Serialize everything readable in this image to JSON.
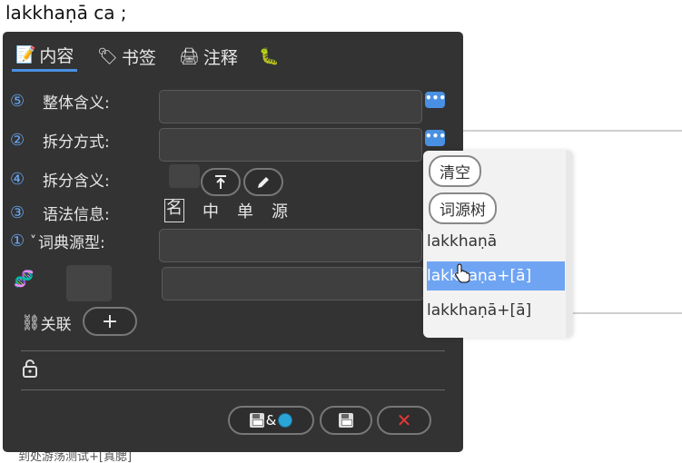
{
  "background": {
    "title_text": "lakkhaṇā  ca          ;",
    "bottom_text": "到处游荡测试+[真腮]"
  },
  "tabs": [
    {
      "icon": "📝",
      "label": "内容"
    },
    {
      "icon": "🏷",
      "label": "书签"
    },
    {
      "icon": "🖨",
      "label": "注释"
    },
    {
      "icon": "🐛",
      "label": ""
    }
  ],
  "rows": {
    "meaning": {
      "num": "⑤",
      "label": "整体含义:"
    },
    "split_method": {
      "num": "②",
      "label": "拆分方式:"
    },
    "split_meaning": {
      "num": "④",
      "label": "拆分含义:"
    },
    "grammar": {
      "num": "③",
      "label": "语法信息:",
      "tags": [
        "名",
        "中",
        "单",
        "源"
      ]
    },
    "dict_base": {
      "num": "①",
      "label": "词典源型:",
      "chevron": "˅"
    },
    "dna_icon": "🧬"
  },
  "chip_label": "•••",
  "relation": {
    "icon": "⛓",
    "label": "关联",
    "add": "+"
  },
  "lock_icon": "🔒",
  "footer": {
    "save_share_amp": "&",
    "cancel_symbol": "✕"
  },
  "dropdown": {
    "clear": "清空",
    "etymology_tree": "词源树",
    "items": [
      "lakkhaṇā",
      "lakkhaṇa+[ā]",
      "lakkhaṇā+[ā]"
    ],
    "selected_index": 1
  },
  "colors": {
    "accent": "#4a90e2",
    "panel": "#333333",
    "selected": "#6fa4f3",
    "cancel": "#e53935"
  }
}
